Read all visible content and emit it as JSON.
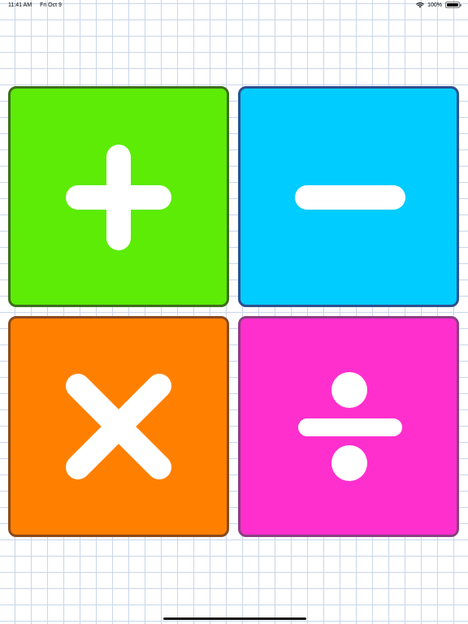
{
  "status_bar": {
    "time": "11:41 AM",
    "date": "Fri Oct 9",
    "battery": "100%",
    "icons": [
      "wifi-icon",
      "battery-icon"
    ]
  },
  "tiles": [
    {
      "operation": "addition",
      "icon": "plus-icon",
      "color": "#5cec06",
      "border": "#3e6e1e"
    },
    {
      "operation": "subtraction",
      "icon": "minus-icon",
      "color": "#00ccff",
      "border": "#2f4f8f"
    },
    {
      "operation": "multiplication",
      "icon": "multiply-icon",
      "color": "#ff8000",
      "border": "#8a4a1f"
    },
    {
      "operation": "division",
      "icon": "divide-icon",
      "color": "#ff2fce",
      "border": "#8a3f82"
    }
  ],
  "colors": {
    "grid_line": "#c9d6ea",
    "background": "#ffffff",
    "symbol": "#ffffff"
  }
}
